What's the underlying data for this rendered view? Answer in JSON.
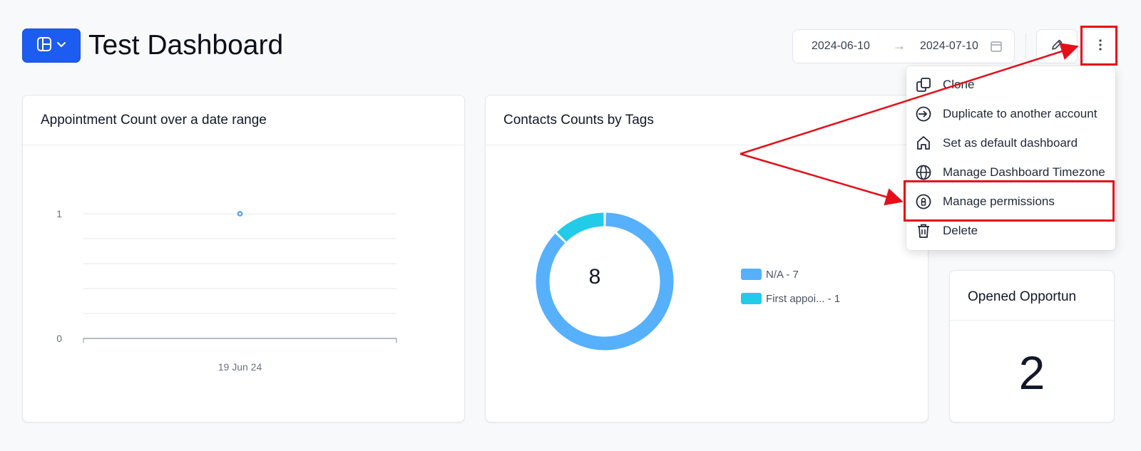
{
  "header": {
    "title": "Test Dashboard",
    "switcher_icon": "layout-icon",
    "date_start": "2024-06-10",
    "date_end": "2024-07-10",
    "date_arrow": "→"
  },
  "menu": {
    "items": [
      {
        "label": "Clone",
        "icon": "clone-icon"
      },
      {
        "label": "Duplicate to another account",
        "icon": "duplicate-icon"
      },
      {
        "label": "Set as default dashboard",
        "icon": "home-icon"
      },
      {
        "label": "Manage Dashboard Timezone",
        "icon": "globe-icon"
      },
      {
        "label": "Manage permissions",
        "icon": "lock-icon"
      },
      {
        "label": "Delete",
        "icon": "trash-icon"
      }
    ]
  },
  "cards": {
    "appointments": {
      "title": "Appointment Count over a date range"
    },
    "tags": {
      "title": "Contacts Counts by Tags",
      "total": "8"
    },
    "opportunities": {
      "title": "Opened Opportun",
      "value": "2"
    }
  },
  "colors": {
    "primary": "#1d5cf0",
    "series_na": "#57b0fb",
    "series_first": "#22cbe8",
    "annotation": "#e3101a"
  },
  "chart_data": [
    {
      "type": "line",
      "title": "Appointment Count over a date range",
      "x": [
        "19 Jun 24"
      ],
      "series": [
        {
          "values": [
            1
          ]
        }
      ],
      "ylim": [
        0,
        1
      ],
      "yticks": [
        "0",
        "1"
      ],
      "grid": true
    },
    {
      "type": "pie",
      "title": "Contacts Counts by Tags",
      "categories": [
        "N/A",
        "First appoi..."
      ],
      "values": [
        7,
        1
      ],
      "legend_labels": [
        "N/A - 7",
        "First appoi... - 1"
      ],
      "center_label": "8",
      "legend": "right"
    }
  ]
}
